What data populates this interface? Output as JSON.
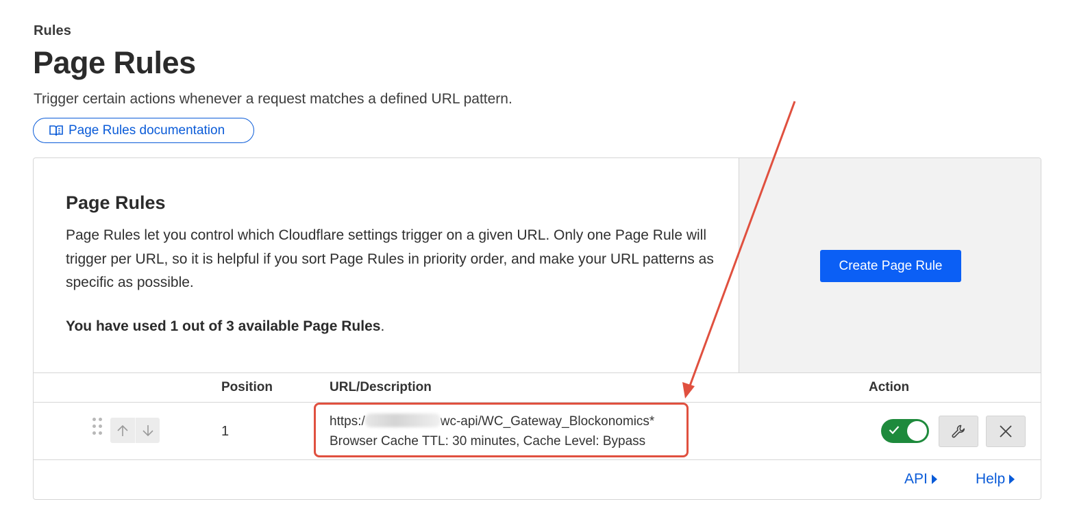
{
  "header": {
    "breadcrumb": "Rules",
    "title": "Page Rules",
    "description": "Trigger certain actions whenever a request matches a defined URL pattern.",
    "doc_link": "Page Rules documentation",
    "doc_icon": "book-icon"
  },
  "card": {
    "heading": "Page Rules",
    "text": "Page Rules let you control which Cloudflare settings trigger on a given URL. Only one Page Rule will trigger per URL, so it is helpful if you sort Page Rules in priority order, and make your URL patterns as specific as possible.",
    "usage_bold": "You have used 1 out of 3 available Page Rules",
    "usage_suffix": ".",
    "create_button": "Create Page Rule"
  },
  "table": {
    "columns": {
      "position": "Position",
      "url": "URL/Description",
      "action": "Action"
    },
    "rows": [
      {
        "position": "1",
        "url_prefix": "https:/",
        "url_suffix": "wc-api/WC_Gateway_Blockonomics*",
        "description": "Browser Cache TTL: 30 minutes, Cache Level: Bypass",
        "enabled": true
      }
    ]
  },
  "footer": {
    "api": "API",
    "help": "Help"
  },
  "colors": {
    "accent": "#0b5ff5",
    "link": "#0a5bd8",
    "toggle_on": "#1e8a3c",
    "annotation": "#e0503f"
  }
}
